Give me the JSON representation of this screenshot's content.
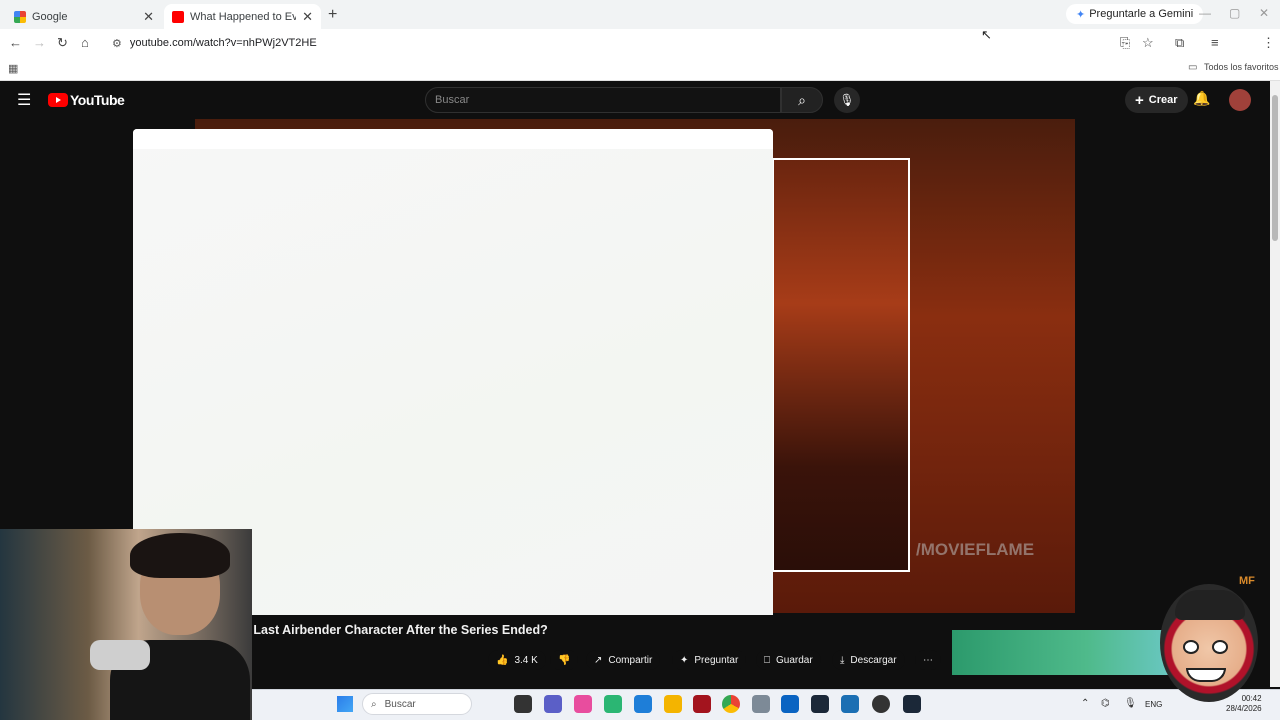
{
  "browser": {
    "tabs": [
      {
        "title": "Google",
        "active": false
      },
      {
        "title": "What Happened to Every Avata",
        "active": true
      }
    ],
    "new_tab": "+",
    "gemini_label": "Preguntarle a Gemini",
    "url": "youtube.com/watch?v=nhPWj2VT2HE",
    "bookmarks_label": "Todos los favoritos"
  },
  "youtube": {
    "logo_text": "YouTube",
    "search_placeholder": "Buscar",
    "create_label": "Crear",
    "watermark": "/MOVIEFLAME",
    "watermark_small": "MF",
    "video_title_visible": "e Last Airbender Character After the Series Ended?",
    "actions": {
      "likes": "3.4 K",
      "share": "Compartir",
      "ask": "Preguntar",
      "save": "Guardar",
      "download": "Descargar",
      "more": "⋯"
    }
  },
  "taskbar": {
    "search_placeholder": "Buscar",
    "lang": "ENG",
    "time": "00:42",
    "date": "28/4/2026"
  },
  "colors": {
    "youtube_red": "#ff0000",
    "dark_bg": "#0f0f0f"
  }
}
